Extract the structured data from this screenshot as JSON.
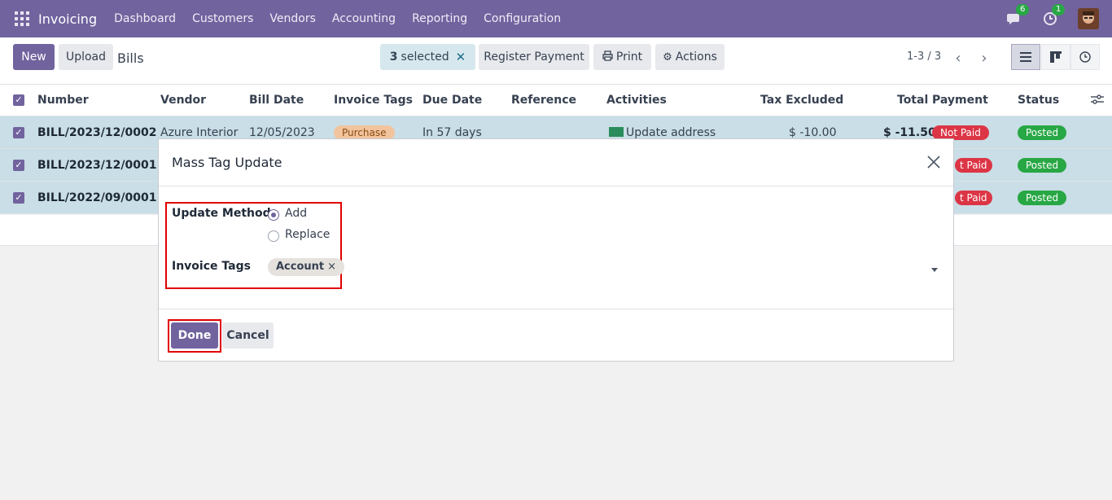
{
  "navbar": {
    "app_name": "Invoicing",
    "menu": [
      "Dashboard",
      "Customers",
      "Vendors",
      "Accounting",
      "Reporting",
      "Configuration"
    ],
    "messages_count": "6",
    "activities_count": "1"
  },
  "control": {
    "new_label": "New",
    "upload_label": "Upload",
    "breadcrumb": "Bills",
    "selected_count": "3",
    "selected_text": "selected",
    "register_payment_label": "Register Payment",
    "print_label": "Print",
    "actions_label": "Actions",
    "pager": "1-3 / 3"
  },
  "table": {
    "headers": [
      "Number",
      "Vendor",
      "Bill Date",
      "Invoice Tags",
      "Due Date",
      "Reference",
      "Activities",
      "Tax Excluded",
      "Total",
      "Payment",
      "Status"
    ],
    "rows": [
      {
        "number": "BILL/2023/12/0002",
        "vendor": "Azure Interior",
        "bill_date": "12/05/2023",
        "tag": "Purchase",
        "due": "In 57 days",
        "activity": "Update address",
        "tax_excluded": "$ -10.00",
        "total": "$ -11.50",
        "payment": "Not Paid",
        "status": "Posted"
      },
      {
        "number": "BILL/2023/12/0001",
        "payment": "t Paid",
        "status": "Posted"
      },
      {
        "number": "BILL/2022/09/0001",
        "payment": "t Paid",
        "status": "Posted"
      }
    ]
  },
  "modal": {
    "title": "Mass Tag Update",
    "update_method_label": "Update Method",
    "option_add": "Add",
    "option_replace": "Replace",
    "selected_option": "Add",
    "invoice_tags_label": "Invoice Tags",
    "tag": "Account",
    "tag_remove": "×",
    "done_label": "Done",
    "cancel_label": "Cancel"
  },
  "colors": {
    "brand": "#71639e",
    "selected_row": "#c9dee6",
    "highlight": "#e00000",
    "posted": "#28a745",
    "not_paid": "#dc3545"
  }
}
